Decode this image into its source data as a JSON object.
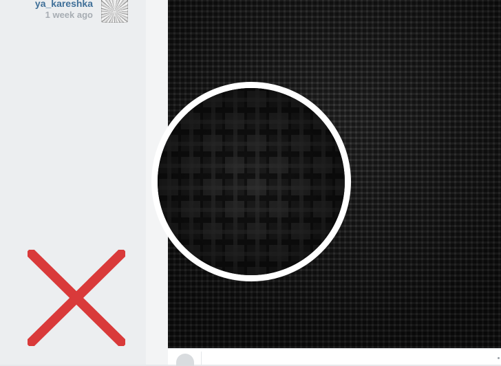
{
  "comment": {
    "username": "ya_kareshka",
    "timestamp": "1 week ago",
    "avatar_icon": "avatar-image"
  },
  "overlay": {
    "mark_icon": "x-mark-icon",
    "mark_color": "#d93a3a"
  },
  "photo": {
    "pattern": "dark woven fabric texture",
    "magnifier_icon": "magnifier-circle"
  },
  "footer": {
    "like_icon": "heart-icon"
  },
  "colors": {
    "username": "#3f6f98",
    "timestamp": "#a7adb3",
    "panel_bg": "#eceef0",
    "photo_bg": "#1a1a1a",
    "magnifier_ring": "#ffffff"
  }
}
